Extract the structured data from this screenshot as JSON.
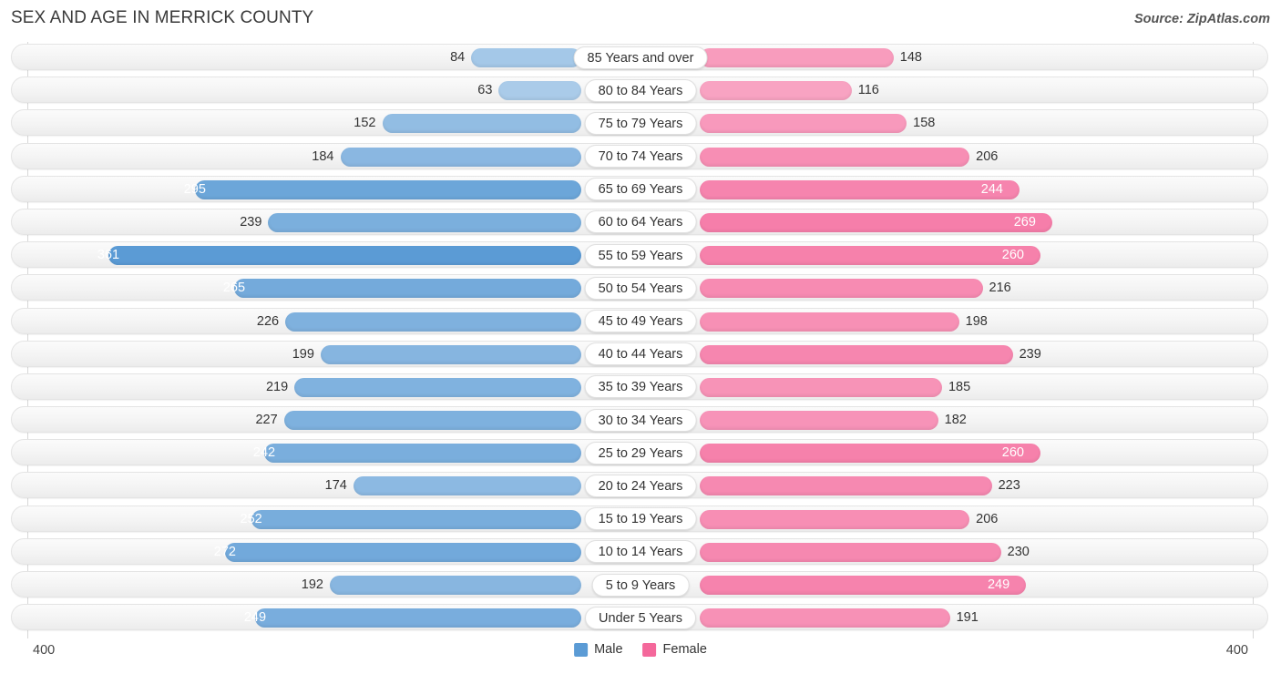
{
  "header": {
    "title": "SEX AND AGE IN MERRICK COUNTY",
    "source": "Source: ZipAtlas.com"
  },
  "footer": {
    "axis_left": "400",
    "axis_right": "400",
    "legend": [
      {
        "label": "Male",
        "color": "#5b9bd5",
        "name": "legend-male"
      },
      {
        "label": "Female",
        "color": "#f4689b",
        "name": "legend-female"
      }
    ]
  },
  "colors": {
    "male": "#5b9bd5",
    "female": "#f4689b",
    "track": "#f4f4f4",
    "axis": "#d8d8d8"
  },
  "chart_data": {
    "type": "bar",
    "subtype": "population-pyramid",
    "title": "SEX AND AGE IN MERRICK COUNTY",
    "xlabel": "",
    "ylabel": "",
    "xlim": [
      400,
      400
    ],
    "axis_max": 400,
    "grid": false,
    "legend_position": "bottom-center",
    "categories": [
      "85 Years and over",
      "80 to 84 Years",
      "75 to 79 Years",
      "70 to 74 Years",
      "65 to 69 Years",
      "60 to 64 Years",
      "55 to 59 Years",
      "50 to 54 Years",
      "45 to 49 Years",
      "40 to 44 Years",
      "35 to 39 Years",
      "30 to 34 Years",
      "25 to 29 Years",
      "20 to 24 Years",
      "15 to 19 Years",
      "10 to 14 Years",
      "5 to 9 Years",
      "Under 5 Years"
    ],
    "series": [
      {
        "name": "Male",
        "color": "#5b9bd5",
        "values": [
          84,
          63,
          152,
          184,
          295,
          239,
          361,
          265,
          226,
          199,
          219,
          227,
          242,
          174,
          252,
          272,
          192,
          249
        ]
      },
      {
        "name": "Female",
        "color": "#f4689b",
        "values": [
          148,
          116,
          158,
          206,
          244,
          269,
          260,
          216,
          198,
          239,
          185,
          182,
          260,
          223,
          206,
          230,
          249,
          191
        ]
      }
    ]
  },
  "rows": [
    {
      "label": "85 Years and over",
      "male": 84,
      "female": 148,
      "male_inside": false,
      "female_inside": false
    },
    {
      "label": "80 to 84 Years",
      "male": 63,
      "female": 116,
      "male_inside": false,
      "female_inside": false
    },
    {
      "label": "75 to 79 Years",
      "male": 152,
      "female": 158,
      "male_inside": false,
      "female_inside": false
    },
    {
      "label": "70 to 74 Years",
      "male": 184,
      "female": 206,
      "male_inside": false,
      "female_inside": false
    },
    {
      "label": "65 to 69 Years",
      "male": 295,
      "female": 244,
      "male_inside": true,
      "female_inside": true
    },
    {
      "label": "60 to 64 Years",
      "male": 239,
      "female": 269,
      "male_inside": false,
      "female_inside": true
    },
    {
      "label": "55 to 59 Years",
      "male": 361,
      "female": 260,
      "male_inside": true,
      "female_inside": true
    },
    {
      "label": "50 to 54 Years",
      "male": 265,
      "female": 216,
      "male_inside": true,
      "female_inside": false
    },
    {
      "label": "45 to 49 Years",
      "male": 226,
      "female": 198,
      "male_inside": false,
      "female_inside": false
    },
    {
      "label": "40 to 44 Years",
      "male": 199,
      "female": 239,
      "male_inside": false,
      "female_inside": false
    },
    {
      "label": "35 to 39 Years",
      "male": 219,
      "female": 185,
      "male_inside": false,
      "female_inside": false
    },
    {
      "label": "30 to 34 Years",
      "male": 227,
      "female": 182,
      "male_inside": false,
      "female_inside": false
    },
    {
      "label": "25 to 29 Years",
      "male": 242,
      "female": 260,
      "male_inside": true,
      "female_inside": true
    },
    {
      "label": "20 to 24 Years",
      "male": 174,
      "female": 223,
      "male_inside": false,
      "female_inside": false
    },
    {
      "label": "15 to 19 Years",
      "male": 252,
      "female": 206,
      "male_inside": true,
      "female_inside": false
    },
    {
      "label": "10 to 14 Years",
      "male": 272,
      "female": 230,
      "male_inside": true,
      "female_inside": false
    },
    {
      "label": "5 to 9 Years",
      "male": 192,
      "female": 249,
      "male_inside": false,
      "female_inside": true
    },
    {
      "label": "Under 5 Years",
      "male": 249,
      "female": 191,
      "male_inside": true,
      "female_inside": false
    }
  ]
}
